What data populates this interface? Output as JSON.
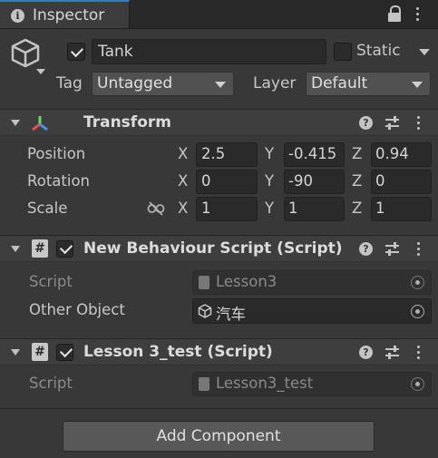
{
  "tab": {
    "title": "Inspector"
  },
  "header": {
    "active": true,
    "name": "Tank",
    "static_label": "Static",
    "tag_label": "Tag",
    "tag_value": "Untagged",
    "layer_label": "Layer",
    "layer_value": "Default"
  },
  "transform": {
    "title": "Transform",
    "rows": [
      {
        "label": "Position",
        "x_label": "X",
        "x": "2.5",
        "y_label": "Y",
        "y": "-0.415",
        "z_label": "Z",
        "z": "0.94"
      },
      {
        "label": "Rotation",
        "x_label": "X",
        "x": "0",
        "y_label": "Y",
        "y": "-90",
        "z_label": "Z",
        "z": "0"
      },
      {
        "label": "Scale",
        "x_label": "X",
        "x": "1",
        "y_label": "Y",
        "y": "1",
        "z_label": "Z",
        "z": "1"
      }
    ]
  },
  "script1": {
    "title": "New Behaviour Script (Script)",
    "script_label": "Script",
    "script_value": "Lesson3",
    "other_label": "Other Object",
    "other_value": "汽车"
  },
  "script2": {
    "title": "Lesson 3_test (Script)",
    "script_label": "Script",
    "script_value": "Lesson3_test"
  },
  "footer": {
    "add_component": "Add Component"
  },
  "colors": {
    "tab_accent": "#3a79bb",
    "panel_bg": "#383838",
    "field_bg": "#2a2a2a"
  }
}
